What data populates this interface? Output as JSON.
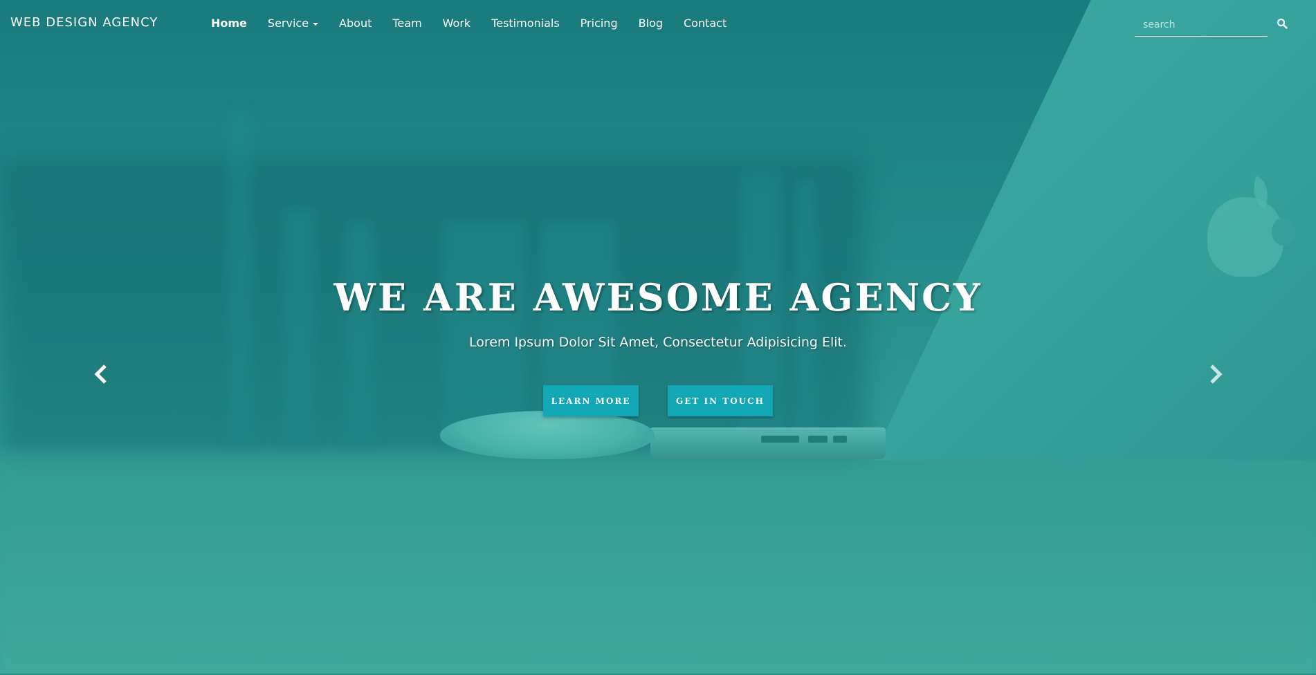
{
  "brand": "WEB DESIGN AGENCY",
  "nav": {
    "items": [
      {
        "label": "Home",
        "active": true
      },
      {
        "label": "Service",
        "has_dropdown": true
      },
      {
        "label": "About"
      },
      {
        "label": "Team"
      },
      {
        "label": "Work"
      },
      {
        "label": "Testimonials"
      },
      {
        "label": "Pricing"
      },
      {
        "label": "Blog"
      },
      {
        "label": "Contact"
      }
    ]
  },
  "search": {
    "placeholder": "search",
    "value": "",
    "icon": "search-icon"
  },
  "hero": {
    "title": "WE ARE AWESOME AGENCY",
    "subtitle": "Lorem Ipsum Dolor Sit Amet, Consectetur Adipisicing Elit.",
    "buttons": {
      "learn_more": "LEARN MORE",
      "get_in_touch": "GET IN TOUCH"
    },
    "prev_icon": "chevron-left-icon",
    "next_icon": "chevron-right-icon"
  },
  "colors": {
    "accent": "#12a7b4",
    "overlay": "#2f8f8c",
    "text": "#ffffff"
  }
}
